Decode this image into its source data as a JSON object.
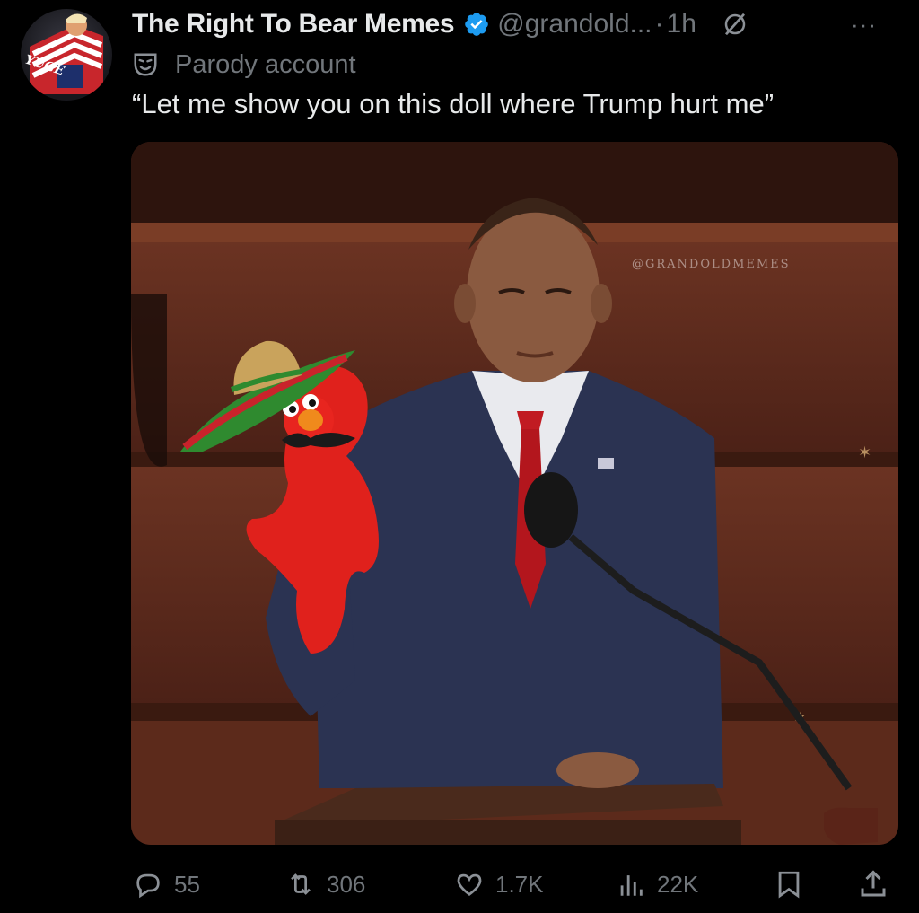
{
  "tweet": {
    "display_name": "The Right To Bear Memes",
    "handle": "@grandold...",
    "separator": "·",
    "time": "1h",
    "label": "Parody account",
    "text": "“Let me show you on this doll where Trump hurt me”",
    "avatar_text": "YUGE",
    "watermark": "@GRANDOLDMEMES",
    "more_label": "···"
  },
  "actions": {
    "replies": "55",
    "reposts": "306",
    "likes": "1.7K",
    "views": "22K"
  },
  "colors": {
    "background": "#000000",
    "text_primary": "#e7e9ea",
    "text_secondary": "#71767b",
    "verified_blue": "#1d9bf0"
  },
  "icons": [
    "verified-badge-icon",
    "grok-icon",
    "more-icon",
    "parody-mask-icon",
    "reply-icon",
    "repost-icon",
    "like-icon",
    "views-icon",
    "bookmark-icon",
    "share-icon"
  ]
}
